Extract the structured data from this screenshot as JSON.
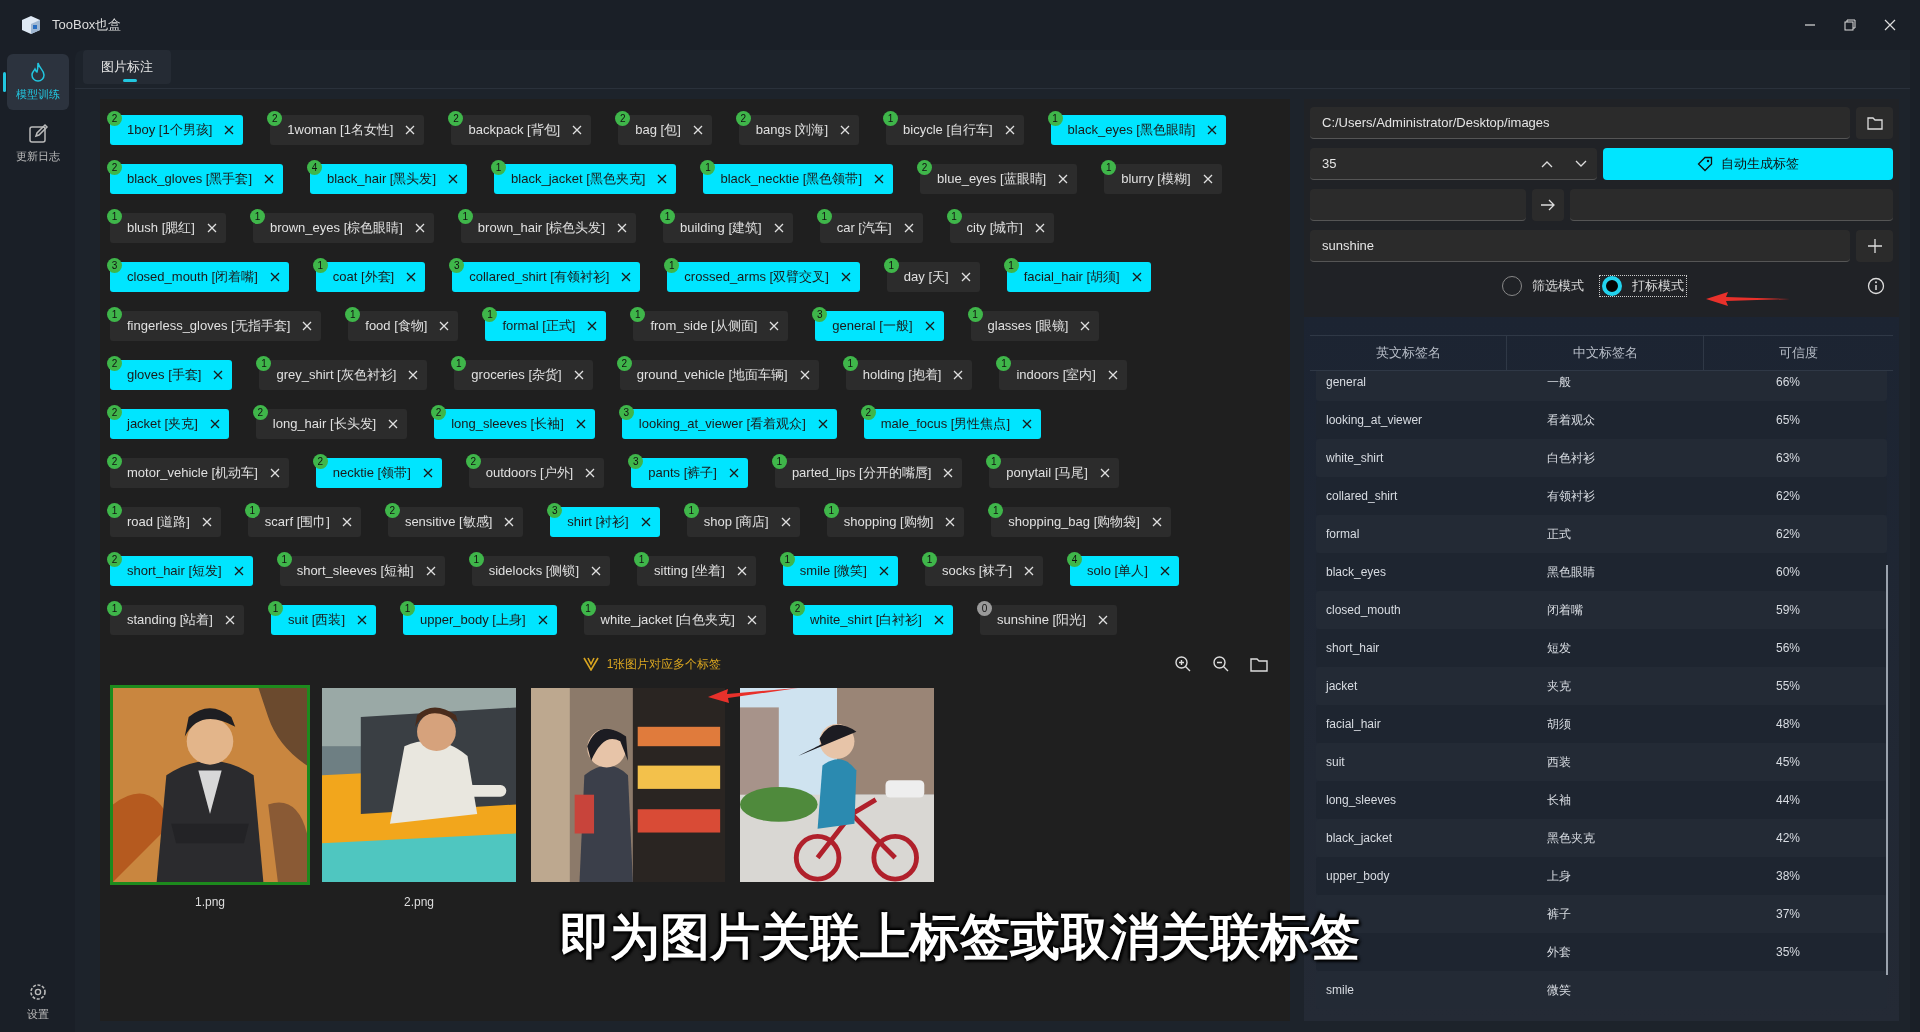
{
  "app": {
    "title": "TooBox也盒"
  },
  "sidebar": {
    "items": [
      {
        "label": "模型训练",
        "selected": true
      },
      {
        "label": "更新日志",
        "selected": false
      }
    ],
    "footer": {
      "label": "设置"
    }
  },
  "tabs": [
    {
      "label": "图片标注",
      "selected": true
    }
  ],
  "tag_rows": [
    [
      {
        "count": "2",
        "label": "1boy [1个男孩]",
        "selected": true
      },
      {
        "count": "2",
        "label": "1woman [1名女性]",
        "selected": false
      },
      {
        "count": "2",
        "label": "backpack [背包]",
        "selected": false
      },
      {
        "count": "2",
        "label": "bag [包]",
        "selected": false
      },
      {
        "count": "2",
        "label": "bangs [刘海]",
        "selected": false
      },
      {
        "count": "1",
        "label": "bicycle [自行车]",
        "selected": false
      },
      {
        "count": "1",
        "label": "black_eyes [黑色眼睛]",
        "selected": true
      }
    ],
    [
      {
        "count": "2",
        "label": "black_gloves [黑手套]",
        "selected": true
      },
      {
        "count": "4",
        "label": "black_hair [黑头发]",
        "selected": true
      },
      {
        "count": "1",
        "label": "black_jacket [黑色夹克]",
        "selected": true
      },
      {
        "count": "1",
        "label": "black_necktie [黑色领带]",
        "selected": true
      },
      {
        "count": "2",
        "label": "blue_eyes [蓝眼睛]",
        "selected": false
      },
      {
        "count": "1",
        "label": "blurry [模糊]",
        "selected": false
      }
    ],
    [
      {
        "count": "1",
        "label": "blush [腮红]",
        "selected": false
      },
      {
        "count": "1",
        "label": "brown_eyes [棕色眼睛]",
        "selected": false
      },
      {
        "count": "1",
        "label": "brown_hair [棕色头发]",
        "selected": false
      },
      {
        "count": "1",
        "label": "building [建筑]",
        "selected": false
      },
      {
        "count": "1",
        "label": "car [汽车]",
        "selected": false
      },
      {
        "count": "1",
        "label": "city [城市]",
        "selected": false
      }
    ],
    [
      {
        "count": "3",
        "label": "closed_mouth [闭着嘴]",
        "selected": true
      },
      {
        "count": "1",
        "label": "coat [外套]",
        "selected": true
      },
      {
        "count": "3",
        "label": "collared_shirt [有领衬衫]",
        "selected": true
      },
      {
        "count": "1",
        "label": "crossed_arms [双臂交叉]",
        "selected": true
      },
      {
        "count": "1",
        "label": "day [天]",
        "selected": false
      },
      {
        "count": "1",
        "label": "facial_hair [胡须]",
        "selected": true
      }
    ],
    [
      {
        "count": "1",
        "label": "fingerless_gloves [无指手套]",
        "selected": false
      },
      {
        "count": "1",
        "label": "food [食物]",
        "selected": false
      },
      {
        "count": "1",
        "label": "formal [正式]",
        "selected": true
      },
      {
        "count": "1",
        "label": "from_side [从侧面]",
        "selected": false
      },
      {
        "count": "3",
        "label": "general [一般]",
        "selected": true
      },
      {
        "count": "1",
        "label": "glasses [眼镜]",
        "selected": false
      }
    ],
    [
      {
        "count": "2",
        "label": "gloves [手套]",
        "selected": true
      },
      {
        "count": "1",
        "label": "grey_shirt [灰色衬衫]",
        "selected": false
      },
      {
        "count": "1",
        "label": "groceries [杂货]",
        "selected": false
      },
      {
        "count": "2",
        "label": "ground_vehicle [地面车辆]",
        "selected": false
      },
      {
        "count": "1",
        "label": "holding [抱着]",
        "selected": false
      },
      {
        "count": "1",
        "label": "indoors [室内]",
        "selected": false
      }
    ],
    [
      {
        "count": "2",
        "label": "jacket [夹克]",
        "selected": true
      },
      {
        "count": "2",
        "label": "long_hair [长头发]",
        "selected": false
      },
      {
        "count": "2",
        "label": "long_sleeves [长袖]",
        "selected": true
      },
      {
        "count": "3",
        "label": "looking_at_viewer [看着观众]",
        "selected": true
      },
      {
        "count": "2",
        "label": "male_focus [男性焦点]",
        "selected": true
      }
    ],
    [
      {
        "count": "2",
        "label": "motor_vehicle [机动车]",
        "selected": false
      },
      {
        "count": "2",
        "label": "necktie [领带]",
        "selected": true
      },
      {
        "count": "2",
        "label": "outdoors [户外]",
        "selected": false
      },
      {
        "count": "3",
        "label": "pants [裤子]",
        "selected": true
      },
      {
        "count": "1",
        "label": "parted_lips [分开的嘴唇]",
        "selected": false
      },
      {
        "count": "1",
        "label": "ponytail [马尾]",
        "selected": false
      }
    ],
    [
      {
        "count": "1",
        "label": "road [道路]",
        "selected": false
      },
      {
        "count": "1",
        "label": "scarf [围巾]",
        "selected": false
      },
      {
        "count": "2",
        "label": "sensitive [敏感]",
        "selected": false
      },
      {
        "count": "3",
        "label": "shirt [衬衫]",
        "selected": true
      },
      {
        "count": "1",
        "label": "shop [商店]",
        "selected": false
      },
      {
        "count": "1",
        "label": "shopping [购物]",
        "selected": false
      },
      {
        "count": "1",
        "label": "shopping_bag [购物袋]",
        "selected": false
      }
    ],
    [
      {
        "count": "2",
        "label": "short_hair [短发]",
        "selected": true
      },
      {
        "count": "1",
        "label": "short_sleeves [短袖]",
        "selected": false
      },
      {
        "count": "1",
        "label": "sidelocks [侧锁]",
        "selected": false
      },
      {
        "count": "1",
        "label": "sitting [坐着]",
        "selected": false
      },
      {
        "count": "1",
        "label": "smile [微笑]",
        "selected": true
      },
      {
        "count": "1",
        "label": "socks [袜子]",
        "selected": false
      },
      {
        "count": "4",
        "label": "solo [单人]",
        "selected": true
      }
    ],
    [
      {
        "count": "1",
        "label": "standing [站着]",
        "selected": false
      },
      {
        "count": "1",
        "label": "suit [西装]",
        "selected": true
      },
      {
        "count": "1",
        "label": "upper_body [上身]",
        "selected": true
      },
      {
        "count": "1",
        "label": "white_jacket [白色夹克]",
        "selected": false
      },
      {
        "count": "2",
        "label": "white_shirt [白衬衫]",
        "selected": true
      },
      {
        "count": "0",
        "label": "sunshine [阳光]",
        "selected": false
      }
    ]
  ],
  "notice": "1张图片对应多个标签",
  "images": [
    {
      "caption": "1.png",
      "selected": true
    },
    {
      "caption": "2.png",
      "selected": false
    },
    {
      "selected": false
    },
    {
      "selected": false
    }
  ],
  "controls": {
    "path": "C:/Users/Administrator/Desktop/images",
    "threshold": "35",
    "auto_button": "自动生成标签",
    "new_tag": "sunshine",
    "modes": [
      {
        "label": "筛选模式",
        "selected": false
      },
      {
        "label": "打标模式",
        "selected": true
      }
    ]
  },
  "table": {
    "columns": [
      "英文标签名",
      "中文标签名",
      "可信度"
    ],
    "rows": [
      {
        "english": "general",
        "chinese": "一般",
        "confidence": "66%"
      },
      {
        "english": "looking_at_viewer",
        "chinese": "看着观众",
        "confidence": "65%"
      },
      {
        "english": "white_shirt",
        "chinese": "白色衬衫",
        "confidence": "63%"
      },
      {
        "english": "collared_shirt",
        "chinese": "有领衬衫",
        "confidence": "62%"
      },
      {
        "english": "formal",
        "chinese": "正式",
        "confidence": "62%"
      },
      {
        "english": "black_eyes",
        "chinese": "黑色眼睛",
        "confidence": "60%"
      },
      {
        "english": "closed_mouth",
        "chinese": "闭着嘴",
        "confidence": "59%"
      },
      {
        "english": "short_hair",
        "chinese": "短发",
        "confidence": "56%"
      },
      {
        "english": "jacket",
        "chinese": "夹克",
        "confidence": "55%"
      },
      {
        "english": "facial_hair",
        "chinese": "胡须",
        "confidence": "48%"
      },
      {
        "english": "suit",
        "chinese": "西装",
        "confidence": "45%"
      },
      {
        "english": "long_sleeves",
        "chinese": "长袖",
        "confidence": "44%"
      },
      {
        "english": "black_jacket",
        "chinese": "黑色夹克",
        "confidence": "42%"
      },
      {
        "english": "upper_body",
        "chinese": "上身",
        "confidence": "38%"
      },
      {
        "chinese": "裤子",
        "confidence": "37%"
      },
      {
        "chinese": "外套",
        "confidence": "35%"
      },
      {
        "english": "smile",
        "chinese": "微笑"
      }
    ]
  },
  "subtitle": "即为图片关联上标签或取消关联标签"
}
